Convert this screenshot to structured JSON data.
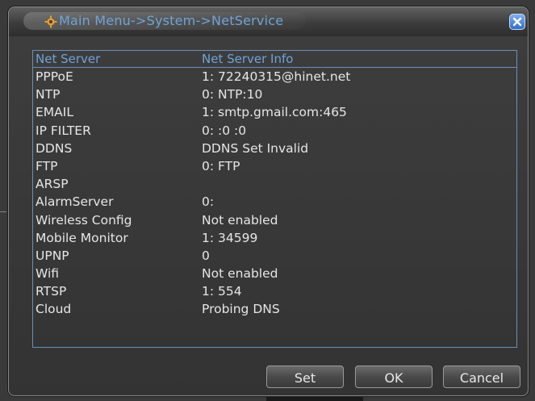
{
  "window": {
    "title": "Main Menu->System->NetService"
  },
  "list": {
    "headers": {
      "col1": "Net Server",
      "col2": "Net Server Info"
    },
    "rows": [
      {
        "name": "PPPoE",
        "info": "1: 72240315@hinet.net"
      },
      {
        "name": "NTP",
        "info": "0: NTP:10"
      },
      {
        "name": "EMAIL",
        "info": "1: smtp.gmail.com:465"
      },
      {
        "name": "IP FILTER",
        "info": "0: :0 :0"
      },
      {
        "name": "DDNS",
        "info": "DDNS Set Invalid"
      },
      {
        "name": "FTP",
        "info": "0: FTP"
      },
      {
        "name": "ARSP",
        "info": ""
      },
      {
        "name": "AlarmServer",
        "info": "0:"
      },
      {
        "name": "Wireless Config",
        "info": "Not enabled"
      },
      {
        "name": "Mobile Monitor",
        "info": "1: 34599"
      },
      {
        "name": "UPNP",
        "info": "0"
      },
      {
        "name": "Wifi",
        "info": "Not enabled"
      },
      {
        "name": "RTSP",
        "info": "1: 554"
      },
      {
        "name": "Cloud",
        "info": "Probing DNS"
      }
    ]
  },
  "buttons": {
    "set": "Set",
    "ok": "OK",
    "cancel": "Cancel"
  },
  "icons": {
    "title": "gear-icon",
    "close": "close-icon"
  },
  "colors": {
    "title_text": "#6fa3d8",
    "panel_border": "#6a8fb8",
    "row_text": "#e6e6e6",
    "close_button": "#2f6ec9"
  }
}
